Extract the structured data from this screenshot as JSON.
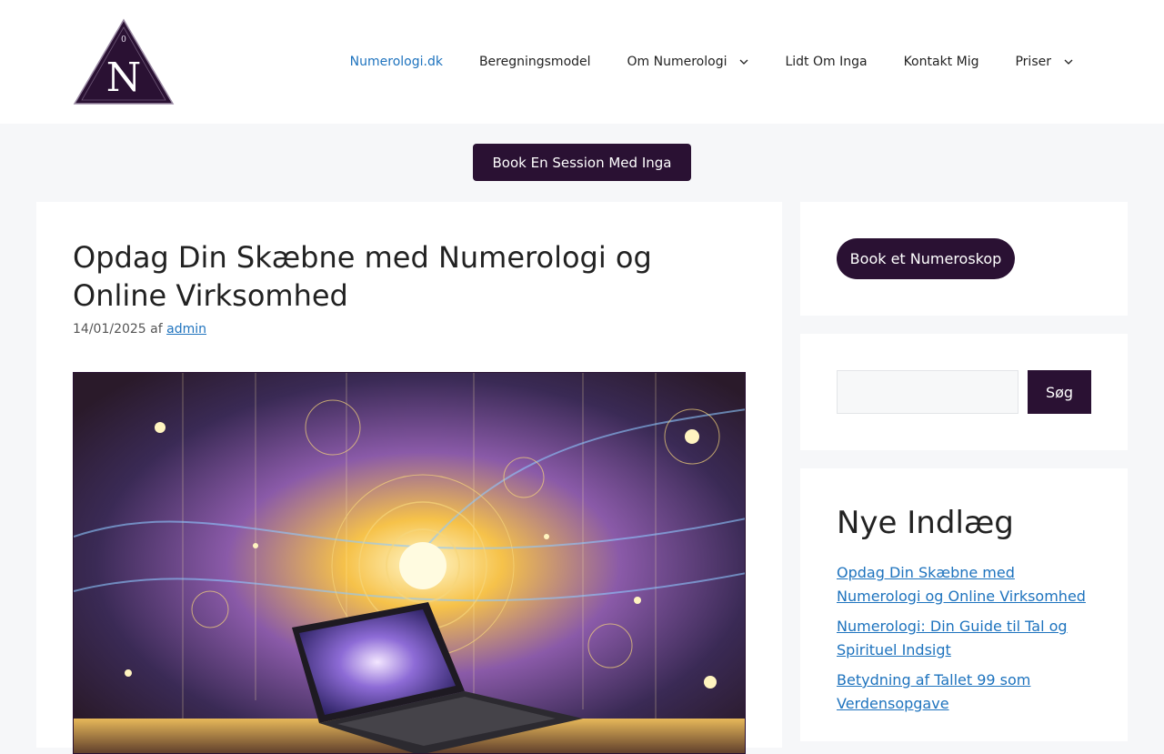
{
  "header": {
    "logo": {
      "letter": "N",
      "small_digit": "0"
    },
    "nav": [
      {
        "label": "Numerologi.dk",
        "active": true,
        "has_dropdown": false
      },
      {
        "label": "Beregningsmodel",
        "active": false,
        "has_dropdown": false
      },
      {
        "label": "Om Numerologi",
        "active": false,
        "has_dropdown": true
      },
      {
        "label": "Lidt Om Inga",
        "active": false,
        "has_dropdown": false
      },
      {
        "label": "Kontakt Mig",
        "active": false,
        "has_dropdown": false
      },
      {
        "label": "Priser",
        "active": false,
        "has_dropdown": true
      }
    ]
  },
  "cta": {
    "book_session_label": "Book En Session Med Inga"
  },
  "post": {
    "title": "Opdag Din Skæbne med Numerologi og Online Virksomhed",
    "date": "14/01/2025",
    "by": "af",
    "author": "admin"
  },
  "sidebar": {
    "numeroskop_label": "Book et Numeroskop",
    "search": {
      "placeholder": "",
      "button_label": "Søg"
    },
    "recent_title": "Nye Indlæg",
    "recent_posts": [
      "Opdag Din Skæbne med Numerologi og Online Virksomhed",
      "Numerologi: Din Guide til Tal og Spirituel Indsigt",
      "Betydning af Tallet 99 som Verdensopgave"
    ]
  },
  "colors": {
    "brand": "#2a1133",
    "link": "#1e73be",
    "background": "#f6f7f9"
  }
}
